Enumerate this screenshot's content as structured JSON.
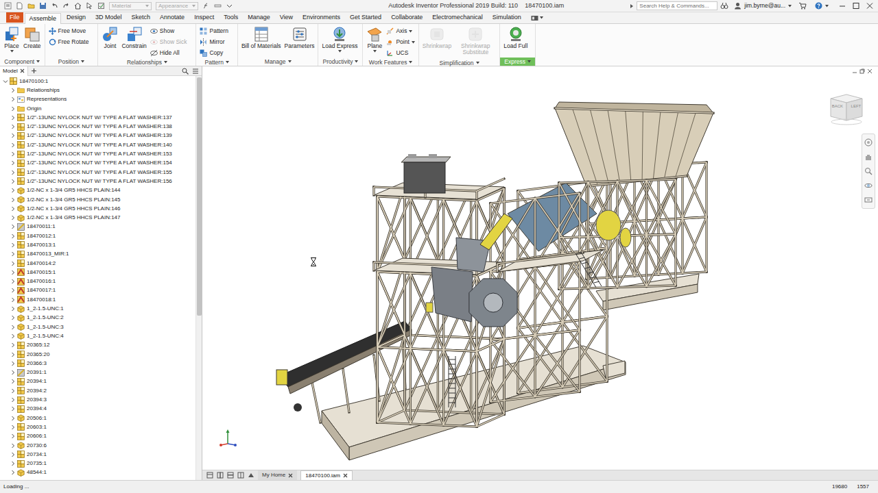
{
  "window": {
    "title": "Autodesk Inventor Professional 2019 Build: 110",
    "document": "18470100.iam"
  },
  "quick_access": {
    "material": {
      "label": "Material",
      "disabled": true
    },
    "appearance": {
      "label": "Appearance",
      "disabled": true
    }
  },
  "search": {
    "placeholder": "Search Help & Commands..."
  },
  "user": {
    "name": "jim.byrne@au..."
  },
  "file_tab": "File",
  "ribbon_tabs": [
    {
      "label": "Assemble",
      "selected": true
    },
    {
      "label": "Design",
      "selected": false
    },
    {
      "label": "3D Model",
      "selected": false
    },
    {
      "label": "Sketch",
      "selected": false
    },
    {
      "label": "Annotate",
      "selected": false
    },
    {
      "label": "Inspect",
      "selected": false
    },
    {
      "label": "Tools",
      "selected": false
    },
    {
      "label": "Manage",
      "selected": false
    },
    {
      "label": "View",
      "selected": false
    },
    {
      "label": "Environments",
      "selected": false
    },
    {
      "label": "Get Started",
      "selected": false
    },
    {
      "label": "Collaborate",
      "selected": false
    },
    {
      "label": "Electromechanical",
      "selected": false
    },
    {
      "label": "Simulation",
      "selected": false
    }
  ],
  "ribbon_groups": [
    {
      "label": "Component",
      "menu": true,
      "highlighted": false,
      "commands": [
        {
          "label": "Place",
          "kind": "large",
          "disabled": false,
          "dropdown": true
        },
        {
          "label": "Create",
          "kind": "large",
          "disabled": false,
          "dropdown": false
        }
      ]
    },
    {
      "label": "Position",
      "menu": true,
      "highlighted": false,
      "commands": [
        {
          "label": "Free Move",
          "kind": "small",
          "disabled": false,
          "dropdown": false
        },
        {
          "label": "Free Rotate",
          "kind": "small",
          "disabled": false,
          "dropdown": false
        }
      ]
    },
    {
      "label": "Relationships",
      "menu": true,
      "highlighted": false,
      "commands": [
        {
          "label": "Joint",
          "kind": "large",
          "disabled": false,
          "dropdown": false
        },
        {
          "label": "Constrain",
          "kind": "large",
          "disabled": false,
          "dropdown": false
        },
        {
          "label": "Show",
          "kind": "small",
          "disabled": false,
          "dropdown": false
        },
        {
          "label": "Show Sick",
          "kind": "small",
          "disabled": true,
          "dropdown": false
        },
        {
          "label": "Hide All",
          "kind": "small",
          "disabled": false,
          "dropdown": false
        }
      ]
    },
    {
      "label": "Pattern",
      "menu": true,
      "highlighted": false,
      "commands": [
        {
          "label": "Pattern",
          "kind": "small",
          "disabled": false,
          "dropdown": false
        },
        {
          "label": "Mirror",
          "kind": "small",
          "disabled": false,
          "dropdown": false
        },
        {
          "label": "Copy",
          "kind": "small",
          "disabled": false,
          "dropdown": false
        }
      ]
    },
    {
      "label": "Manage",
      "menu": true,
      "highlighted": false,
      "commands": [
        {
          "label": "Bill of Materials",
          "kind": "large",
          "disabled": false,
          "dropdown": false
        },
        {
          "label": "Parameters",
          "kind": "large",
          "disabled": false,
          "dropdown": false
        }
      ]
    },
    {
      "label": "Productivity",
      "menu": false,
      "highlighted": false,
      "commands": [
        {
          "label": "Load Express",
          "kind": "large",
          "disabled": false,
          "dropdown": true
        }
      ]
    },
    {
      "label": "Work Features",
      "menu": false,
      "highlighted": false,
      "commands": [
        {
          "label": "Plane",
          "kind": "large",
          "disabled": false,
          "dropdown": true
        },
        {
          "label": "Axis",
          "kind": "small",
          "disabled": false,
          "dropdown": true
        },
        {
          "label": "Point",
          "kind": "small",
          "disabled": false,
          "dropdown": true
        },
        {
          "label": "UCS",
          "kind": "small",
          "disabled": false,
          "dropdown": false
        }
      ]
    },
    {
      "label": "Simplification",
      "menu": true,
      "highlighted": false,
      "commands": [
        {
          "label": "Shrinkwrap",
          "kind": "large",
          "disabled": true,
          "dropdown": false
        },
        {
          "label": "Shrinkwrap Substitute",
          "kind": "large",
          "disabled": true,
          "dropdown": false
        }
      ]
    },
    {
      "label": "Express",
      "menu": false,
      "highlighted": true,
      "commands": [
        {
          "label": "Load Full",
          "kind": "large",
          "disabled": false,
          "dropdown": false
        }
      ]
    }
  ],
  "browser": {
    "tab": "Model",
    "scrollbar": {
      "level": 0.6
    },
    "items": [
      {
        "label": "18470100:1",
        "depth": 0,
        "expanded": true,
        "kind": "assembly"
      },
      {
        "label": "Relationships",
        "depth": 1,
        "expanded": false,
        "kind": "folder"
      },
      {
        "label": "Representations",
        "depth": 1,
        "expanded": false,
        "kind": "representations"
      },
      {
        "label": "Origin",
        "depth": 1,
        "expanded": false,
        "kind": "folder"
      },
      {
        "label": "1/2\"-13UNC NYLOCK NUT W/ TYPE A FLAT WASHER:137",
        "depth": 1,
        "expanded": false,
        "kind": "assembly"
      },
      {
        "label": "1/2\"-13UNC NYLOCK NUT W/ TYPE A FLAT WASHER:138",
        "depth": 1,
        "expanded": false,
        "kind": "assembly"
      },
      {
        "label": "1/2\"-13UNC NYLOCK NUT W/ TYPE A FLAT WASHER:139",
        "depth": 1,
        "expanded": false,
        "kind": "assembly"
      },
      {
        "label": "1/2\"-13UNC NYLOCK NUT W/ TYPE A FLAT WASHER:140",
        "depth": 1,
        "expanded": false,
        "kind": "assembly"
      },
      {
        "label": "1/2\"-13UNC NYLOCK NUT W/ TYPE A FLAT WASHER:153",
        "depth": 1,
        "expanded": false,
        "kind": "assembly"
      },
      {
        "label": "1/2\"-13UNC NYLOCK NUT W/ TYPE A FLAT WASHER:154",
        "depth": 1,
        "expanded": false,
        "kind": "assembly"
      },
      {
        "label": "1/2\"-13UNC NYLOCK NUT W/ TYPE A FLAT WASHER:155",
        "depth": 1,
        "expanded": false,
        "kind": "assembly"
      },
      {
        "label": "1/2\"-13UNC NYLOCK NUT W/ TYPE A FLAT WASHER:156",
        "depth": 1,
        "expanded": false,
        "kind": "assembly"
      },
      {
        "label": "1/2-NC x 1-3/4 GR5 HHCS PLAIN:144",
        "depth": 1,
        "expanded": false,
        "kind": "part"
      },
      {
        "label": "1/2-NC x 1-3/4 GR5 HHCS PLAIN:145",
        "depth": 1,
        "expanded": false,
        "kind": "part"
      },
      {
        "label": "1/2-NC x 1-3/4 GR5 HHCS PLAIN:146",
        "depth": 1,
        "expanded": false,
        "kind": "part"
      },
      {
        "label": "1/2-NC x 1-3/4 GR5 HHCS PLAIN:147",
        "depth": 1,
        "expanded": false,
        "kind": "part"
      },
      {
        "label": "18470011:1",
        "depth": 1,
        "expanded": false,
        "kind": "weldment"
      },
      {
        "label": "18470012:1",
        "depth": 1,
        "expanded": false,
        "kind": "assembly"
      },
      {
        "label": "18470013:1",
        "depth": 1,
        "expanded": false,
        "kind": "assembly"
      },
      {
        "label": "18470013_MIR:1",
        "depth": 1,
        "expanded": false,
        "kind": "assembly"
      },
      {
        "label": "18470014:2",
        "depth": 1,
        "expanded": false,
        "kind": "assembly"
      },
      {
        "label": "18470015:1",
        "depth": 1,
        "expanded": false,
        "kind": "frame"
      },
      {
        "label": "18470016:1",
        "depth": 1,
        "expanded": false,
        "kind": "frame"
      },
      {
        "label": "18470017:1",
        "depth": 1,
        "expanded": false,
        "kind": "frame"
      },
      {
        "label": "18470018:1",
        "depth": 1,
        "expanded": false,
        "kind": "frame"
      },
      {
        "label": "1_2-1.5-UNC:1",
        "depth": 1,
        "expanded": false,
        "kind": "part"
      },
      {
        "label": "1_2-1.5-UNC:2",
        "depth": 1,
        "expanded": false,
        "kind": "part"
      },
      {
        "label": "1_2-1.5-UNC:3",
        "depth": 1,
        "expanded": false,
        "kind": "part"
      },
      {
        "label": "1_2-1.5-UNC:4",
        "depth": 1,
        "expanded": false,
        "kind": "part"
      },
      {
        "label": "20365:12",
        "depth": 1,
        "expanded": false,
        "kind": "assembly"
      },
      {
        "label": "20365:20",
        "depth": 1,
        "expanded": false,
        "kind": "assembly"
      },
      {
        "label": "20366:3",
        "depth": 1,
        "expanded": false,
        "kind": "assembly"
      },
      {
        "label": "20391:1",
        "depth": 1,
        "expanded": false,
        "kind": "weldment"
      },
      {
        "label": "20394:1",
        "depth": 1,
        "expanded": false,
        "kind": "assembly"
      },
      {
        "label": "20394:2",
        "depth": 1,
        "expanded": false,
        "kind": "assembly"
      },
      {
        "label": "20394:3",
        "depth": 1,
        "expanded": false,
        "kind": "assembly"
      },
      {
        "label": "20394:4",
        "depth": 1,
        "expanded": false,
        "kind": "assembly"
      },
      {
        "label": "20506:1",
        "depth": 1,
        "expanded": false,
        "kind": "part"
      },
      {
        "label": "20603:1",
        "depth": 1,
        "expanded": false,
        "kind": "assembly"
      },
      {
        "label": "20606:1",
        "depth": 1,
        "expanded": false,
        "kind": "assembly"
      },
      {
        "label": "20730:6",
        "depth": 1,
        "expanded": false,
        "kind": "part"
      },
      {
        "label": "20734:1",
        "depth": 1,
        "expanded": false,
        "kind": "assembly"
      },
      {
        "label": "20735:1",
        "depth": 1,
        "expanded": false,
        "kind": "assembly"
      },
      {
        "label": "48544:1",
        "depth": 1,
        "expanded": false,
        "kind": "part"
      }
    ]
  },
  "viewcube": {
    "faces": [
      "BACK",
      "LEFT"
    ]
  },
  "document_tabs": [
    {
      "label": "My Home",
      "selected": false,
      "closable": false
    },
    {
      "label": "18470100.iam",
      "selected": true,
      "closable": true
    }
  ],
  "status_bar": {
    "message": "Loading ...",
    "counts": [
      "19680",
      "1557"
    ]
  }
}
